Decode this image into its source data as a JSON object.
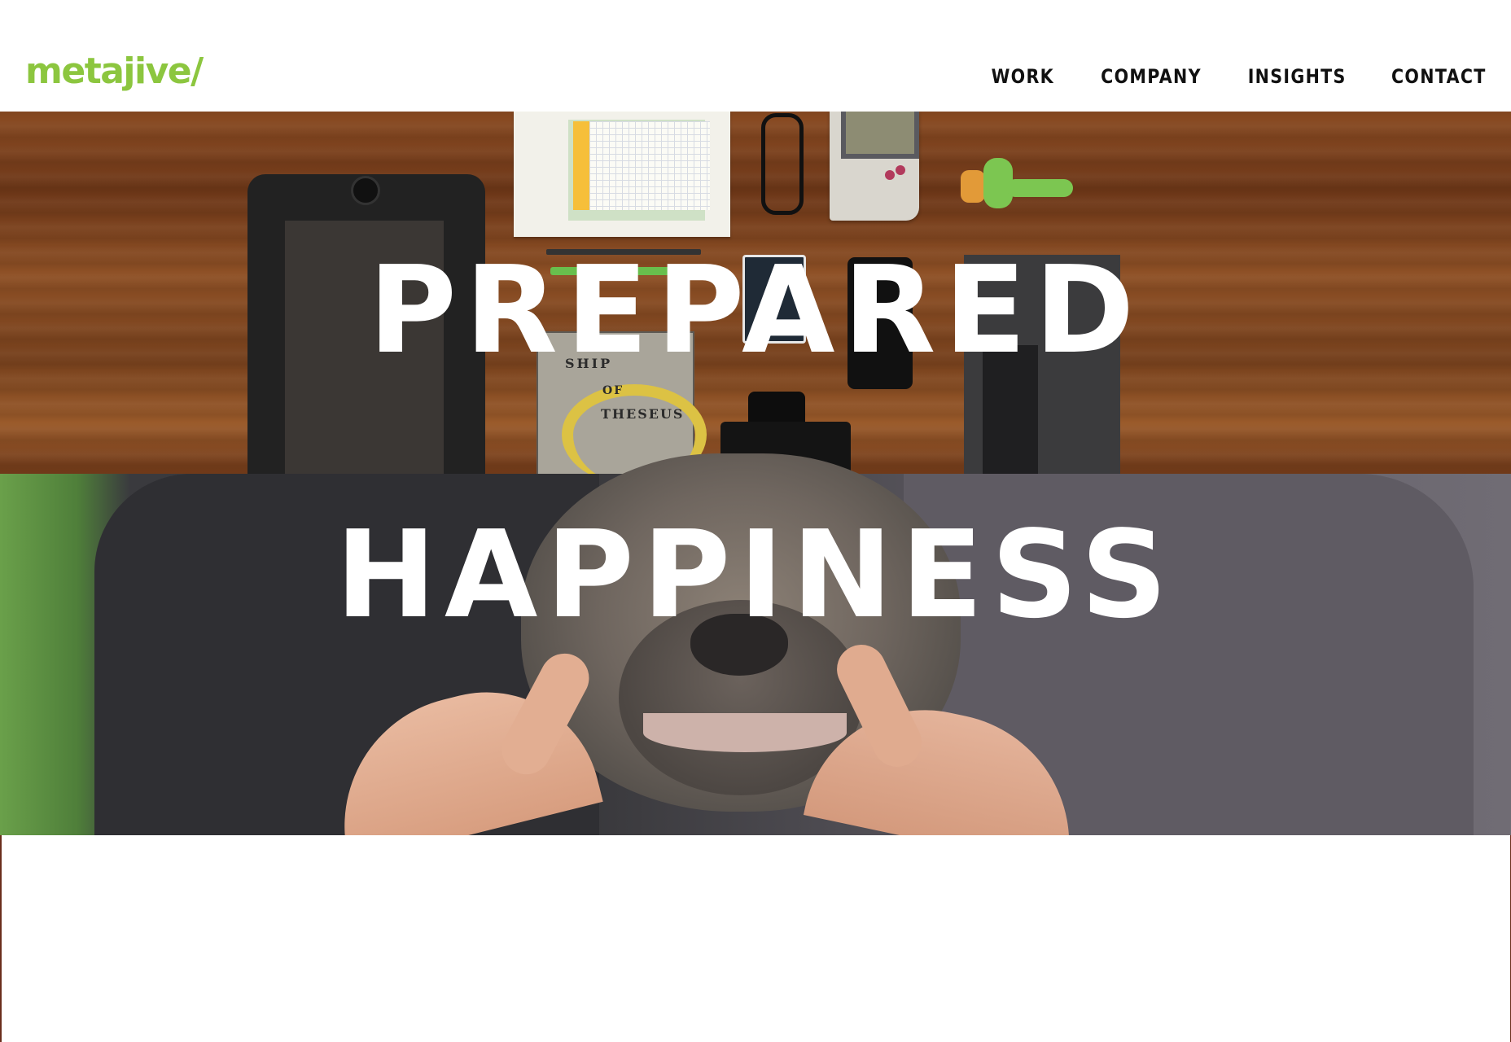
{
  "header": {
    "logo_text": "metajive/",
    "nav": [
      {
        "label": "WORK"
      },
      {
        "label": "COMPANY"
      },
      {
        "label": "INSIGHTS"
      },
      {
        "label": "CONTACT"
      }
    ]
  },
  "hero": {
    "headline_line1": "PREPARED",
    "headline_line2": "HAPPINESS",
    "book_title": {
      "line1": "SHIP",
      "line2": "OF",
      "line3": "THESEUS"
    }
  },
  "colors": {
    "brand": "#8cc63f",
    "nav_text": "#111111",
    "headline": "#ffffff",
    "background": "#ffffff"
  }
}
